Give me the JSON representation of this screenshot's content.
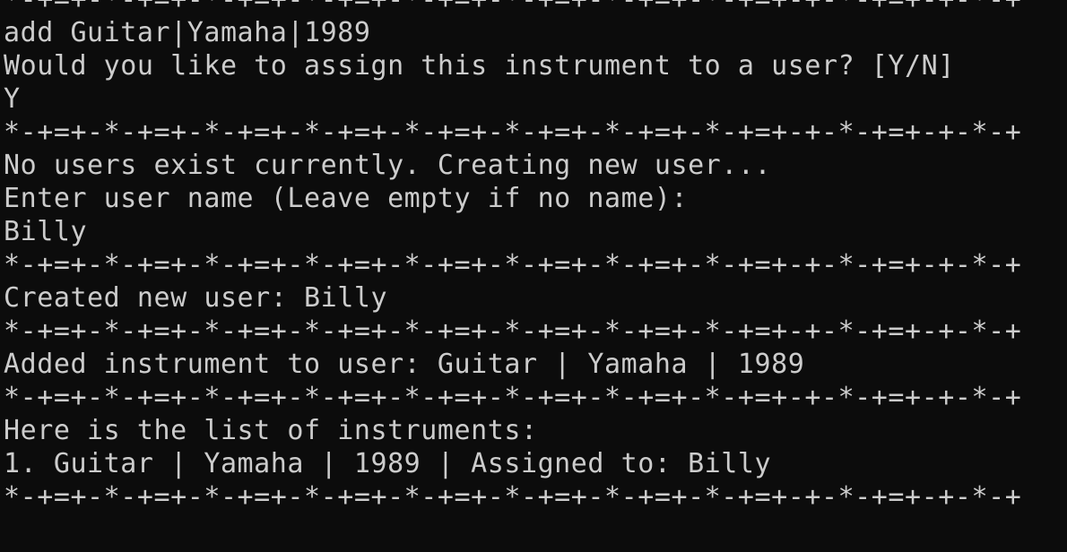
{
  "terminal": {
    "lines": [
      "*-+=+-*-+=+-*-+=+-*-+=+-*-+=+-*-+=+-*-+=+-*-+=+-+-*-+=+-+-*-+",
      "add Guitar|Yamaha|1989",
      "Would you like to assign this instrument to a user? [Y/N]",
      "Y",
      "*-+=+-*-+=+-*-+=+-*-+=+-*-+=+-*-+=+-*-+=+-*-+=+-+-*-+=+-+-*-+",
      "No users exist currently. Creating new user...",
      "Enter user name (Leave empty if no name):",
      "Billy",
      "*-+=+-*-+=+-*-+=+-*-+=+-*-+=+-*-+=+-*-+=+-*-+=+-+-*-+=+-+-*-+",
      "Created new user: Billy",
      "*-+=+-*-+=+-*-+=+-*-+=+-*-+=+-*-+=+-*-+=+-*-+=+-+-*-+=+-+-*-+",
      "Added instrument to user: Guitar | Yamaha | 1989",
      "*-+=+-*-+=+-*-+=+-*-+=+-*-+=+-*-+=+-*-+=+-*-+=+-+-*-+=+-+-*-+",
      "Here is the list of instruments:",
      "1. Guitar | Yamaha | 1989 | Assigned to: Billy",
      "*-+=+-*-+=+-*-+=+-*-+=+-*-+=+-*-+=+-*-+=+-*-+=+-+-*-+=+-+-*-+"
    ]
  }
}
